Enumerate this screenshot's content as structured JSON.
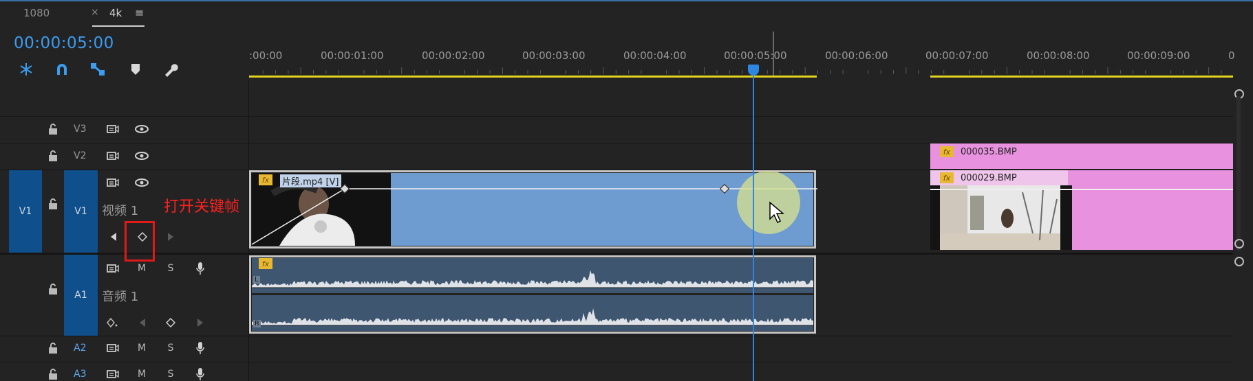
{
  "tabs": {
    "first": "1080",
    "close": "×",
    "active": "4k",
    "menu": "≡"
  },
  "timecode": "00:00:05:00",
  "tools": [
    "snap-icon",
    "magnet-icon",
    "linked-selection-icon",
    "marker-icon",
    "wrench-icon"
  ],
  "ruler": {
    "labels": [
      ":00:00",
      "00:00:01:00",
      "00:00:02:00",
      "00:00:03:00",
      "00:00:04:00",
      "00:00:05:00",
      "00:00:06:00",
      "00:00:07:00",
      "00:00:08:00",
      "00:00:09:00",
      "0"
    ]
  },
  "tracks": {
    "v3": {
      "label": "V3"
    },
    "v2": {
      "label": "V2"
    },
    "v1": {
      "source": "V1",
      "label": "V1",
      "name": "视频 1"
    },
    "a1": {
      "label": "A1",
      "name": "音频 1",
      "mute": "M",
      "solo": "S"
    },
    "a2": {
      "label": "A2",
      "mute": "M",
      "solo": "S"
    },
    "a3": {
      "label": "A3",
      "mute": "M",
      "solo": "S"
    }
  },
  "annotation": "打开关键帧",
  "clips": {
    "video": {
      "fx": "fx",
      "name": "片段.mp4 [V]"
    },
    "audio": {
      "fx": "fx",
      "left_channel": "L",
      "right_channel": "R"
    },
    "image_top": {
      "fx": "fx",
      "name": "000035.BMP"
    },
    "image_bottom": {
      "fx": "fx",
      "name": "000029.BMP"
    }
  },
  "colors": {
    "accent": "#3b9cf0",
    "video_clip": "#6e9bd0",
    "image_clip": "#e892df",
    "work_area": "#e3d41d",
    "annotation": "#ff2020"
  }
}
